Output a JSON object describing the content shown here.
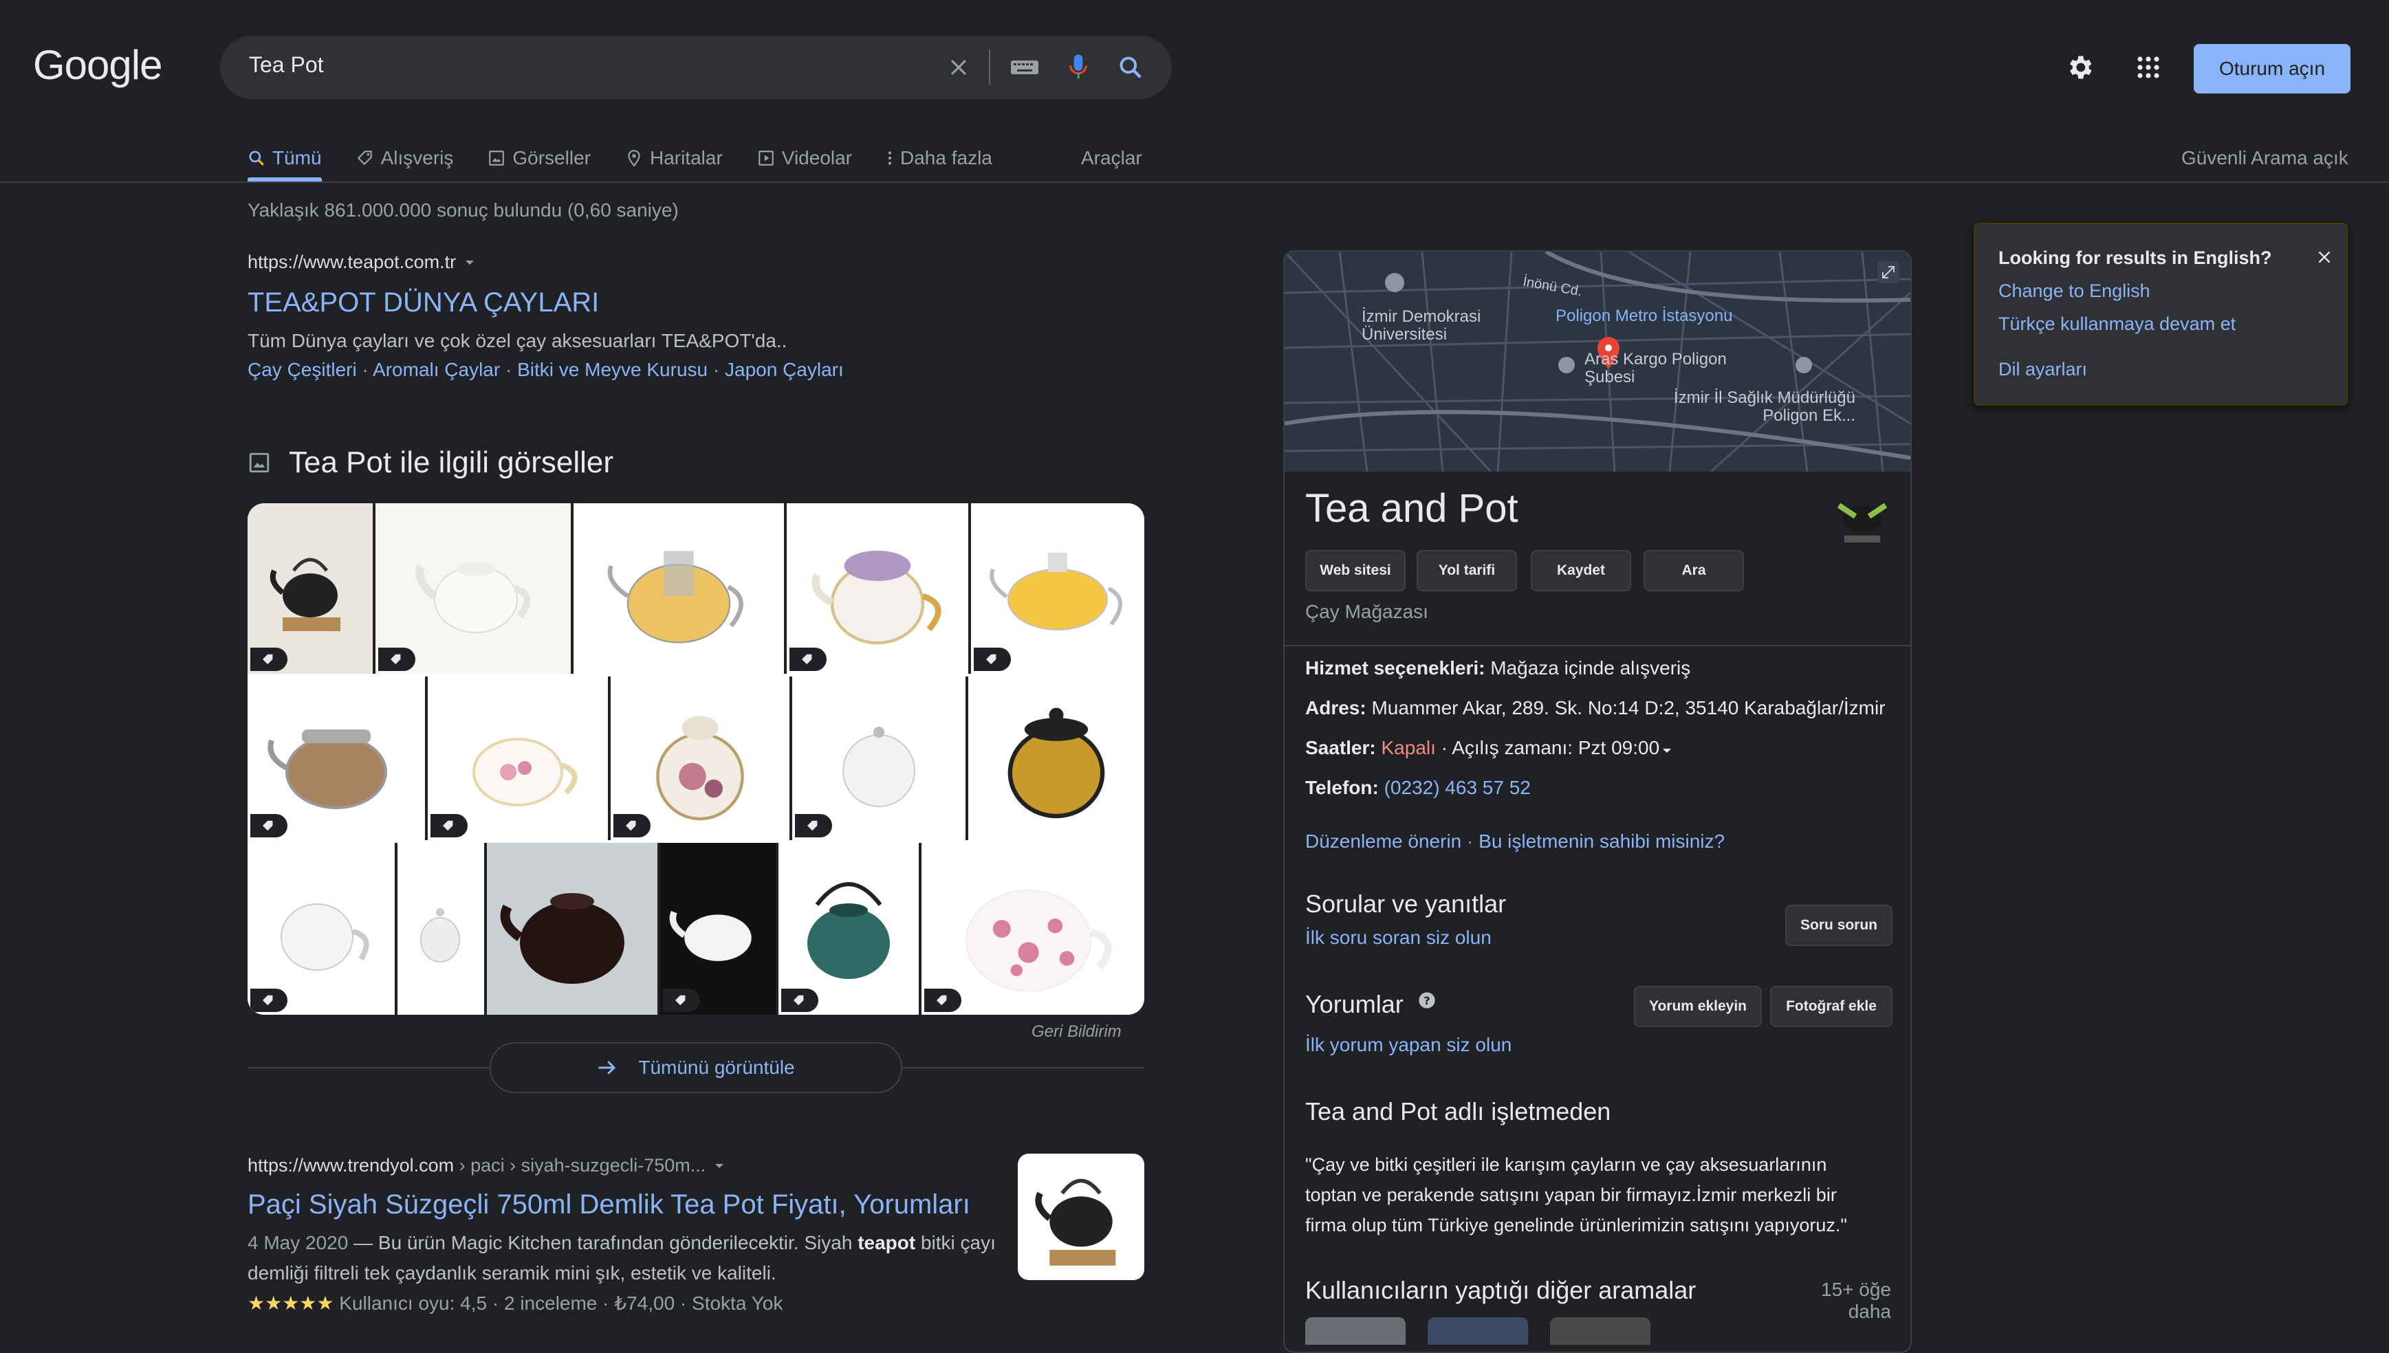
{
  "header": {
    "logo": "Google",
    "search_value": "Tea Pot",
    "signin_label": "Oturum açın"
  },
  "tabs": [
    {
      "label": "Tümü",
      "icon": "search-icon"
    },
    {
      "label": "Alışveriş",
      "icon": "tag-icon"
    },
    {
      "label": "Görseller",
      "icon": "image-icon"
    },
    {
      "label": "Haritalar",
      "icon": "map-pin-icon"
    },
    {
      "label": "Videolar",
      "icon": "play-icon"
    },
    {
      "label": "Daha fazla",
      "icon": "more-vert-icon"
    }
  ],
  "tools_label": "Araçlar",
  "safesearch_label": "Güvenli Arama açık",
  "result_stats": "Yaklaşık 861.000.000 sonuç bulundu (0,60 saniye)",
  "result1": {
    "cite": "https://www.teapot.com.tr",
    "title": "TEA&POT DÜNYA ÇAYLARI",
    "snippet": "Tüm Dünya çayları ve çok özel çay aksesuarları TEA&POT'da..",
    "sitelinks": [
      "Çay Çeşitleri",
      "Aromalı Çaylar",
      "Bitki ve Meyve Kurusu",
      "Japon Çayları"
    ]
  },
  "images": {
    "heading": "Tea Pot ile ilgili görseller",
    "feedback": "Geri Bildirim",
    "view_all": "Tümünü görüntüle"
  },
  "result2": {
    "cite_host": "https://www.trendyol.com",
    "cite_path": " › paci › siyah-suzgecli-750m...",
    "title": "Paçi Siyah Süzgeçli 750ml Demlik Tea Pot Fiyatı, Yorumları",
    "date": "4 May 2020",
    "snippet_a": " — Bu ürün Magic Kitchen tarafından gönderilecektir. Siyah ",
    "snippet_bold": "teapot",
    "snippet_b": " bitki çayı",
    "snippet_line2": "demliği filtreli tek çaydanlık seramik mini şık, estetik ve kaliteli.",
    "rating_stars": "★★★★★",
    "rating_text": " Kullanıcı oyu: 4,5 · 2 inceleme · ₺74,00 · Stokta Yok",
    "rating": 4.5
  },
  "kp": {
    "map_labels": [
      "İzmir Demokrasi Üniversitesi",
      "Poligon Metro İstasyonu",
      "İnönü Cd.",
      "Aras Kargo Poligon Şubesi",
      "İzmir İl Sağlık Müdürlüğü Poligon Ek..."
    ],
    "title": "Tea and Pot",
    "buttons": [
      "Web sitesi",
      "Yol tarifi",
      "Kaydet",
      "Ara"
    ],
    "category": "Çay Mağazası",
    "services_label": "Hizmet seçenekleri:",
    "services_value": " Mağaza içinde alışveriş",
    "address_label": "Adres:",
    "address_value": " Muammer Akar, 289. Sk. No:14 D:2, 35140 Karabağlar/İzmir",
    "hours_label": "Saatler:",
    "hours_status": " Kapalı",
    "hours_next": " · Açılış zamanı: Pzt 09:00",
    "phone_label": "Telefon:",
    "phone_value": " (0232) 463 57 52",
    "suggest_edit": "Düzenleme önerin",
    "own_business": "Bu işletmenin sahibi misiniz?",
    "qa_title": "Sorular ve yanıtlar",
    "qa_link": "İlk soru soran siz olun",
    "qa_button": "Soru sorun",
    "reviews_title": "Yorumlar",
    "reviews_link": "İlk yorum yapan siz olun",
    "add_review": "Yorum ekleyin",
    "add_photo": "Fotoğraf ekle",
    "from_business_title": "Tea and Pot adlı işletmeden",
    "from_business_text1": "\"Çay ve bitki çeşitleri ile karışım çayların ve çay aksesuarlarının",
    "from_business_text2": "toptan ve perakende satışını yapan bir firmayız.İzmir merkezli bir",
    "from_business_text3": "firma olup tüm Türkiye genelinde ürünlerimizin satışını yapıyoruz.\"",
    "also_searched": "Kullanıcıların yaptığı diğer aramalar",
    "more_items": "15+ öğe daha"
  },
  "lang_popup": {
    "title": "Looking for results in English?",
    "change": "Change to English",
    "continue": "Türkçe kullanmaya devam et",
    "settings": "Dil ayarları"
  },
  "colors": {
    "background": "#202124",
    "link": "#8ab4f8",
    "closed": "#f28b82",
    "brand_button": "#8ab4f8"
  }
}
